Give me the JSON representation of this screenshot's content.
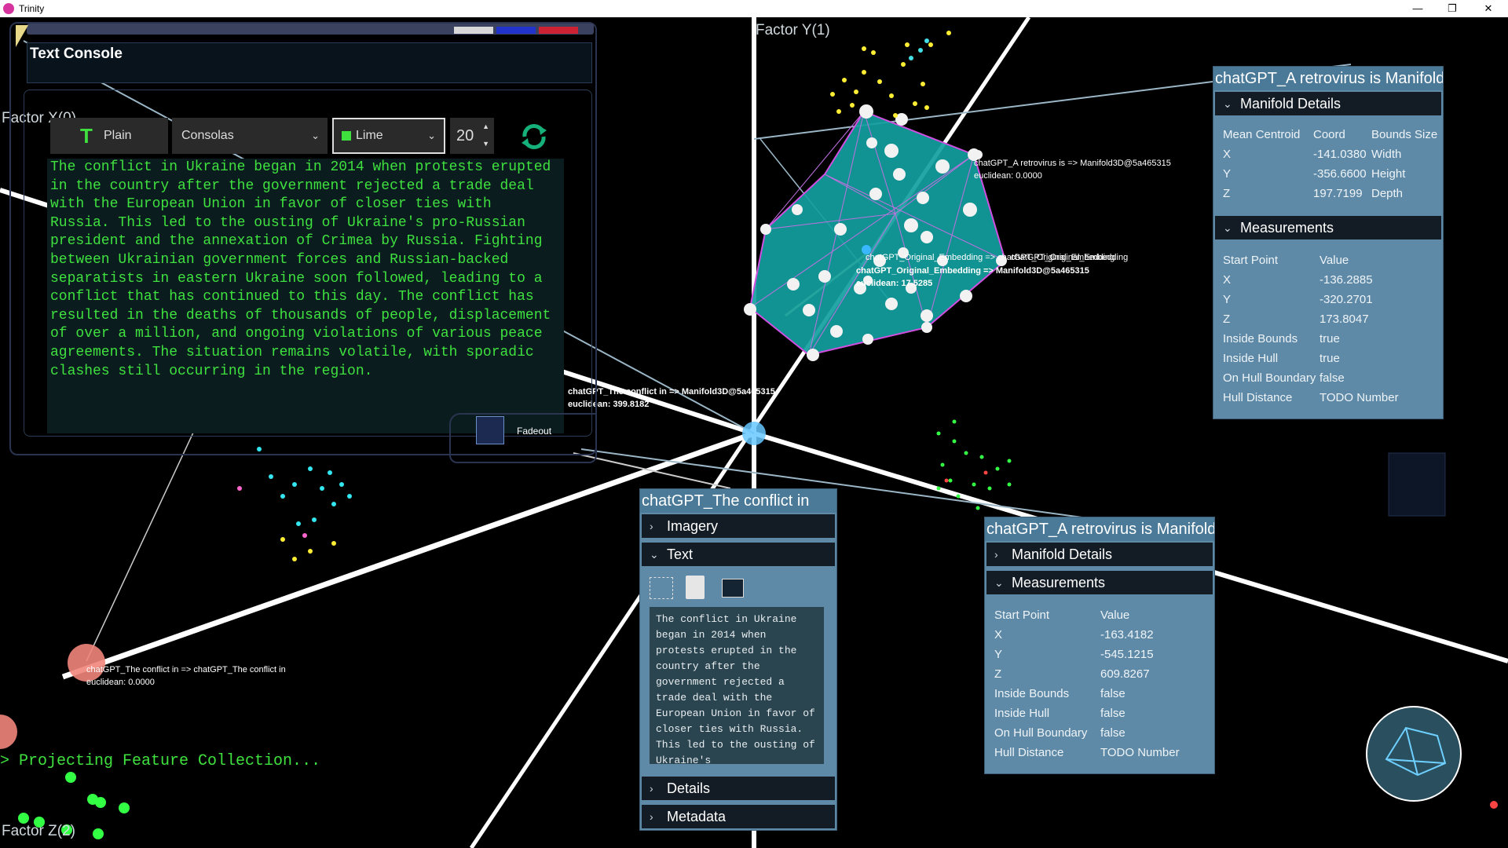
{
  "window": {
    "title": "Trinity",
    "minimize": "—",
    "restore": "❐",
    "close": "✕"
  },
  "axes": {
    "x": "Factor X(0)",
    "y": "Factor Y(1)",
    "z": "Factor Z(2)"
  },
  "console": {
    "title": "Text Console",
    "style_label": "Plain",
    "font": "Consolas",
    "color": "Lime",
    "size": "20",
    "text": "The conflict in Ukraine began in 2014 when protests erupted\nin the country after the government rejected a trade deal\nwith the European Union in favor of closer ties with\nRussia. This led to the ousting of Ukraine's pro-Russian\npresident and the annexation of Crimea by Russia. Fighting\nbetween Ukrainian government forces and Russian-backed\nseparatists in eastern Ukraine soon followed, leading to a\nconflict that has continued to this day. The conflict has\nresulted in the deaths of thousands of people, displacement\nof over a million, and ongoing violations of various peace\nagreements. The situation remains volatile, with sporadic\nclashes still occurring in the region.",
    "fadeout_label": "Fadeout"
  },
  "scene_labels": {
    "manifold_label_1": "chatGPT_A retrovirus is => Manifold3D@5a465315",
    "manifold_label_1b": "euclidean: 0.0000",
    "orig_embed_a": "chatGPT_Original_Embedding",
    "orig_embed_b": "chatGPT_Original_Embedding => chatGPT_Original_Embedding",
    "orig_embed_c": "chatGPT_Original_Embedding => Manifold3D@5a465315",
    "orig_embed_d": "euclidean: 17.5285",
    "conflict_label": "chatGPT_The conflict in => Manifold3D@5a465315",
    "conflict_label_b": "euclidean: 399.8182",
    "origin_label": "chatGPT_The conflict in => chatGPT_The conflict in",
    "origin_label_b": "euclidean: 0.0000"
  },
  "panel_top_right": {
    "title": "chatGPT_A retrovirus is Manifold",
    "section1": "Manifold Details",
    "headers": [
      "Mean Centroid",
      "Coord",
      "Bounds Size"
    ],
    "rows": [
      {
        "k": "X",
        "v": "-141.0380",
        "b": "Width"
      },
      {
        "k": "Y",
        "v": "-356.6600",
        "b": "Height"
      },
      {
        "k": "Z",
        "v": "197.7199",
        "b": "Depth"
      }
    ],
    "section2": "Measurements",
    "m_headers": [
      "Start Point",
      "Value"
    ],
    "m_rows": [
      {
        "k": "X",
        "v": "-136.2885"
      },
      {
        "k": "Y",
        "v": "-320.2701"
      },
      {
        "k": "Z",
        "v": "173.8047"
      },
      {
        "k": "Inside Bounds",
        "v": "true"
      },
      {
        "k": "Inside Hull",
        "v": "true"
      },
      {
        "k": "On Hull Boundary",
        "v": "false"
      },
      {
        "k": "Hull Distance",
        "v": "TODO Number"
      }
    ]
  },
  "panel_conflict": {
    "title": "chatGPT_The conflict in",
    "imagery": "Imagery",
    "text": "Text",
    "mini_text": "The conflict in Ukraine began in 2014 when protests erupted in the country after the government rejected a trade deal with the European Union in favor of closer ties with Russia. This led to the ousting of Ukraine's",
    "details": "Details",
    "metadata": "Metadata"
  },
  "panel_mid_right": {
    "title": "chatGPT_A retrovirus is Manifold",
    "section1": "Manifold Details",
    "section2": "Measurements",
    "m_headers": [
      "Start Point",
      "Value"
    ],
    "m_rows": [
      {
        "k": "X",
        "v": "-163.4182"
      },
      {
        "k": "Y",
        "v": "-545.1215"
      },
      {
        "k": "Z",
        "v": "609.8267"
      },
      {
        "k": "Inside Bounds",
        "v": "false"
      },
      {
        "k": "Inside Hull",
        "v": "false"
      },
      {
        "k": "On Hull Boundary",
        "v": "false"
      },
      {
        "k": "Hull Distance",
        "v": "TODO Number"
      }
    ]
  },
  "status": {
    "prompt": "> Projecting Feature Collection..."
  },
  "colors": {
    "lime": "#3fe13f",
    "teal_hull": "#1aa3a3",
    "hull_edge": "#c05ad8",
    "panel_bg": "#5f8aa7"
  }
}
